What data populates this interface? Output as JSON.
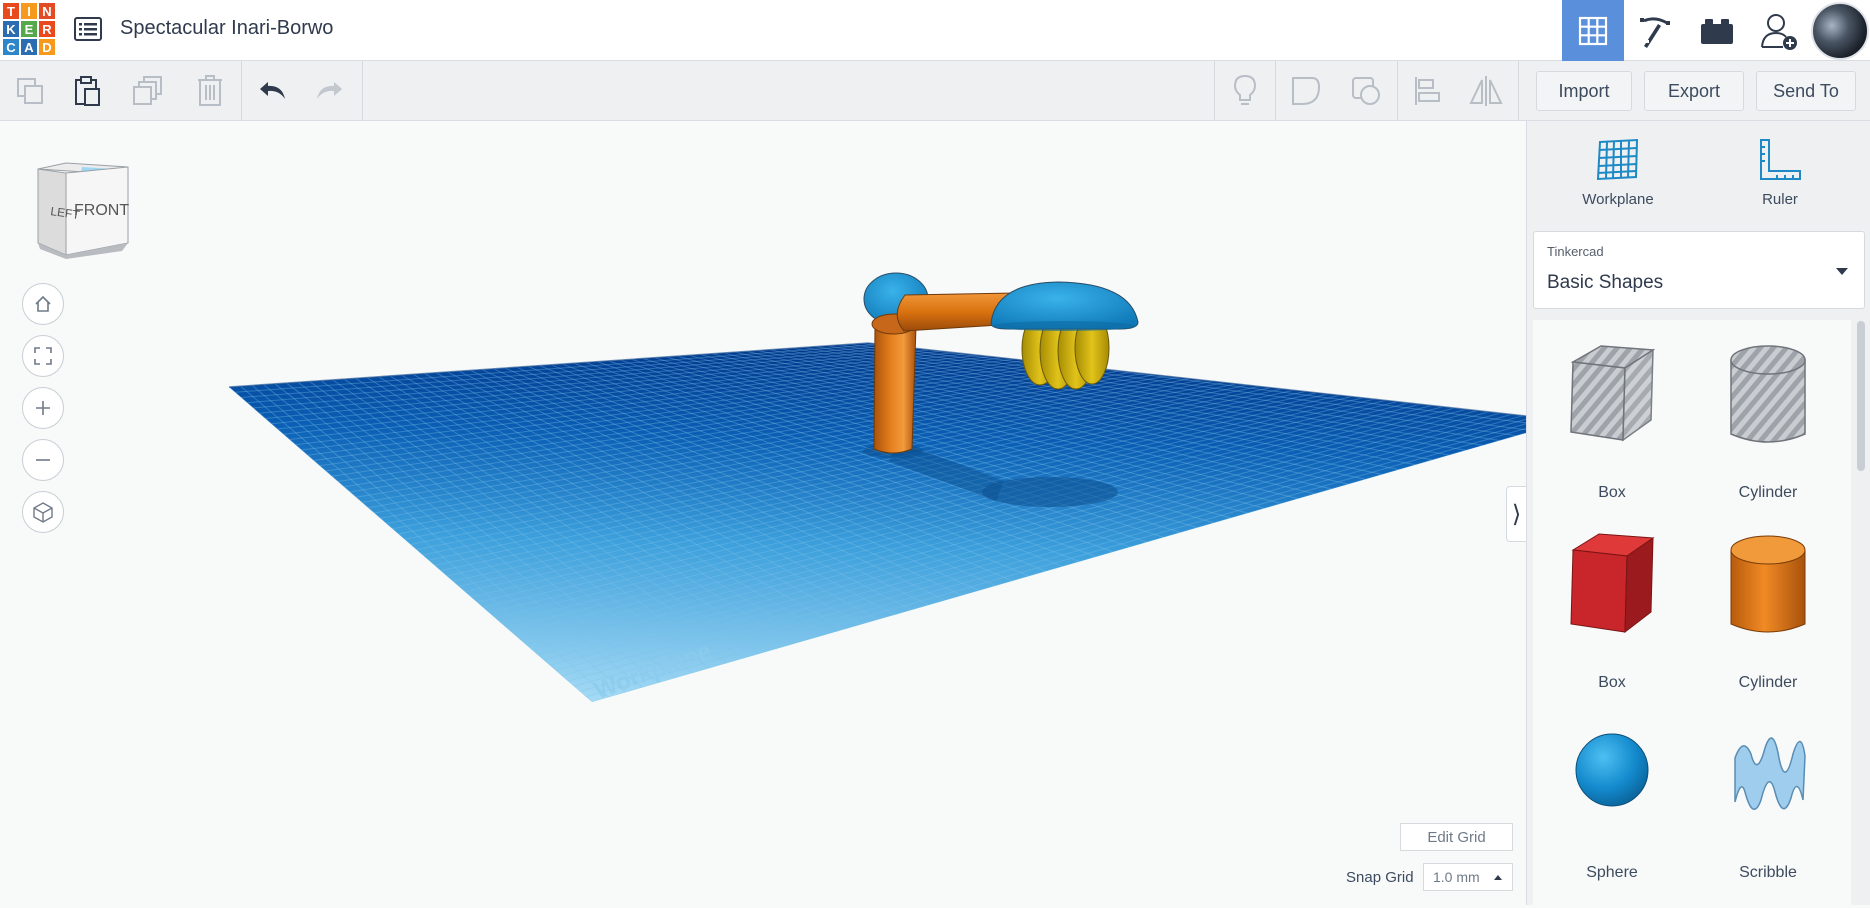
{
  "app": {
    "logo_letters": [
      "T",
      "I",
      "N",
      "K",
      "E",
      "R",
      "C",
      "A",
      "D"
    ],
    "logo_colors": [
      "#e8491d",
      "#f59a1c",
      "#e34b25",
      "#2c6cb0",
      "#55a84b",
      "#e8491d",
      "#2c86c9",
      "#2c6cb0",
      "#f59a1c"
    ],
    "design_title": "Spectacular Inari-Borwo"
  },
  "header": {
    "active_view": "3D Design",
    "buttons": [
      "grid-view-icon",
      "pickaxe-icon",
      "bricks-icon",
      "add-user-icon"
    ]
  },
  "toolbar": {
    "left_icons": [
      "copy-icon",
      "paste-icon",
      "duplicate-icon",
      "delete-icon",
      "undo-icon",
      "redo-icon"
    ],
    "right_icons": [
      "notes-light-icon",
      "hole-shape-icon",
      "solid-shape-icon",
      "align-icon",
      "mirror-icon"
    ],
    "import_label": "Import",
    "export_label": "Export",
    "send_to_label": "Send To"
  },
  "viewcube": {
    "left_label": "LEFT",
    "front_label": "FRONT"
  },
  "view_controls": [
    "home-icon",
    "fit-view-icon",
    "zoom-in-icon",
    "zoom-out-icon",
    "perspective-icon"
  ],
  "workplane": {
    "watermark": "Workplane",
    "edit_grid_label": "Edit Grid",
    "snap_grid_label": "Snap Grid",
    "snap_grid_value": "1.0 mm"
  },
  "panel": {
    "workplane_label": "Workplane",
    "ruler_label": "Ruler",
    "library_source": "Tinkercad",
    "library_name": "Basic Shapes",
    "shapes": [
      {
        "label": "Box",
        "kind": "hole-box"
      },
      {
        "label": "Cylinder",
        "kind": "hole-cylinder"
      },
      {
        "label": "Box",
        "kind": "box",
        "color": "#d22f2f"
      },
      {
        "label": "Cylinder",
        "kind": "cylinder",
        "color": "#e07b18"
      },
      {
        "label": "Sphere",
        "kind": "sphere",
        "color": "#1a8fd0"
      },
      {
        "label": "Scribble",
        "kind": "scribble",
        "color": "#8ec4ea"
      }
    ]
  }
}
